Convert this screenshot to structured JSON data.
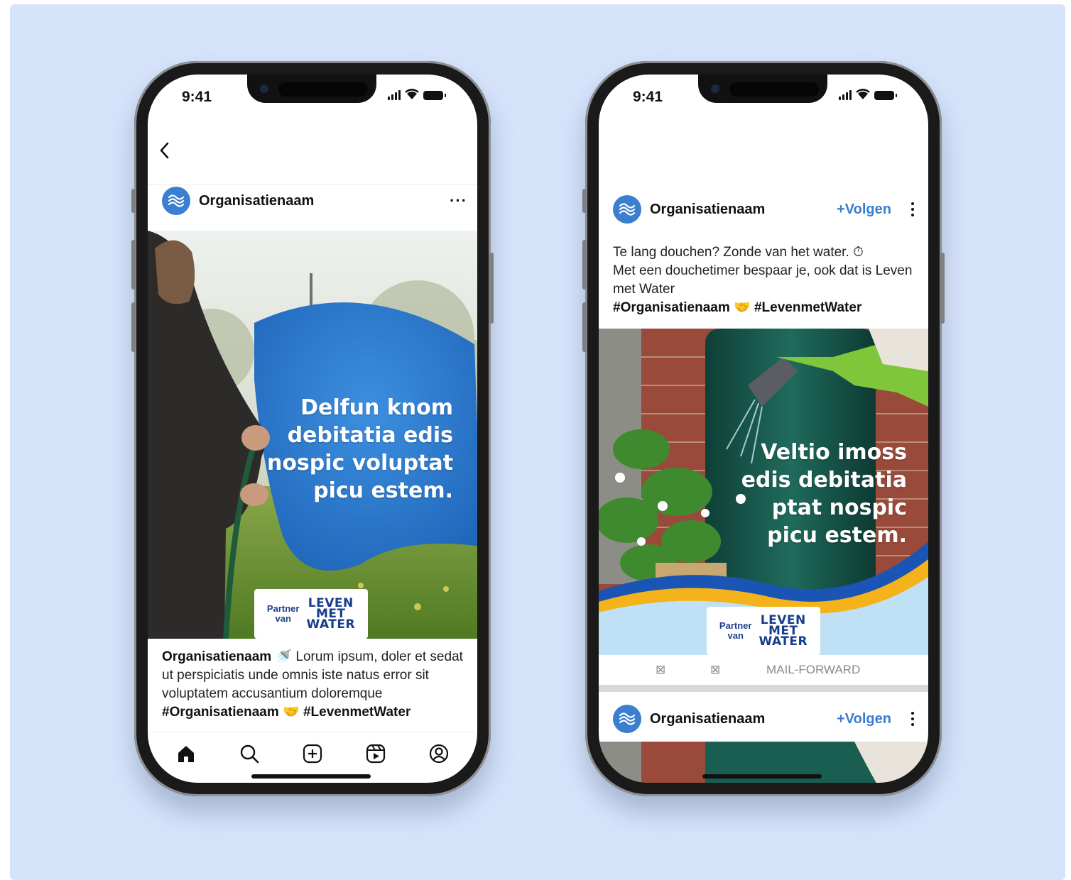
{
  "status": {
    "time": "9:41"
  },
  "left_phone": {
    "header": {
      "back_icon": "chevron-left-icon"
    },
    "post": {
      "org_name": "Organisatienaam",
      "more_label": "···",
      "headline": [
        "Delfun knom",
        "debitatia edis",
        "nospic voluptat",
        "picu estem."
      ],
      "partner_label": [
        "Partner",
        "van"
      ],
      "logo_lines": [
        "LEVEN",
        "MET",
        "WATER"
      ],
      "caption_name": "Organisatienaam",
      "caption_emoji": "🚿",
      "caption_text": "Lorum ipsum, doler et sedat ut perspiciatis unde omnis iste natus error sit voluptatem accusantium doloremque",
      "hashtag_1": "#Organisatienaam",
      "hashtag_emoji": "🤝",
      "hashtag_2": "#LevenmetWater"
    },
    "nav": [
      "home-icon",
      "search-icon",
      "add-post-icon",
      "reels-icon",
      "profile-icon"
    ]
  },
  "right_phone": {
    "post": {
      "org_name": "Organisatienaam",
      "follow_label": "+Volgen",
      "text_line_1": "Te lang douchen? Zonde van het water. ⏱",
      "text_line_2": "Met een douchetimer bespaar je, ook dat is Leven met Water",
      "hashtag_1": "#Organisatienaam",
      "hashtag_emoji": "🤝",
      "hashtag_2": "#LevenmetWater",
      "headline": [
        "Veltio imoss",
        "edis debitatia",
        "ptat nospic",
        "picu estem."
      ],
      "partner_label": [
        "Partner",
        "van"
      ],
      "logo_lines": [
        "LEVEN",
        "MET",
        "WATER"
      ],
      "action_1": "⊠",
      "action_2": "⊠",
      "action_3": "MAIL-FORWARD"
    },
    "post_2": {
      "org_name": "Organisatienaam",
      "follow_label": "+Volgen"
    },
    "android_nav": [
      "menu-icon",
      "square-home-icon",
      "triangle-back-icon"
    ]
  },
  "colors": {
    "background": "#d6e4fb",
    "accent_blue": "#3a7dd0",
    "blob_blue": "#2f7fd4",
    "wave_yellow": "#f4b31a",
    "wave_light": "#bfe0f5",
    "logo_navy": "#173d8c"
  }
}
